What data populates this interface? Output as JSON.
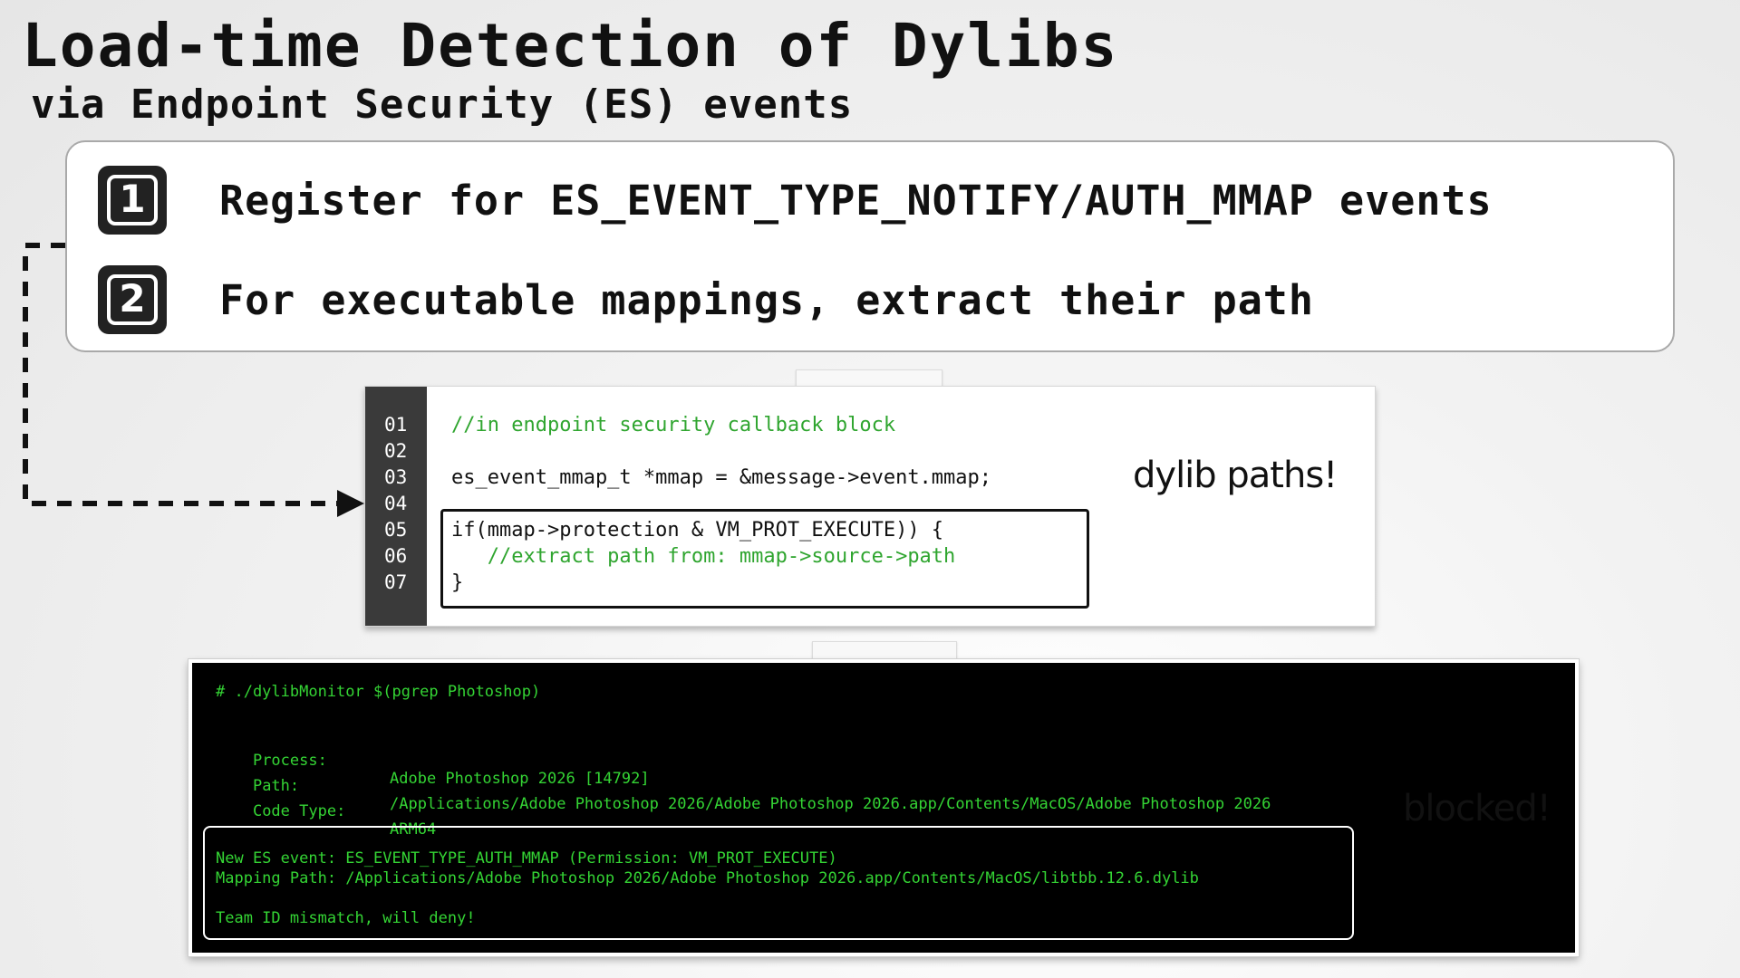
{
  "title": "Load-time Detection of Dylibs",
  "subtitle": "via Endpoint Security (ES) events",
  "steps": [
    {
      "number": "1",
      "text": "Register for ES_EVENT_TYPE_NOTIFY/AUTH_MMAP events"
    },
    {
      "number": "2",
      "text": "For executable mappings, extract their path"
    }
  ],
  "code": {
    "line_numbers": [
      "01",
      "02",
      "03",
      "04",
      "05",
      "06",
      "07"
    ],
    "lines": [
      "//in endpoint security callback block",
      "",
      "es_event_mmap_t *mmap = &message->event.mmap;",
      "",
      "if(mmap->protection & VM_PROT_EXECUTE)) {",
      "   //extract path from: mmap->source->path",
      "}"
    ]
  },
  "annotations": {
    "dylib_paths": "dylib paths!",
    "blocked": "blocked!"
  },
  "terminal": {
    "command": "# ./dylibMonitor $(pgrep Photoshop)",
    "process_label": "Process:",
    "process_value": "Adobe Photoshop 2026 [14792]",
    "path_label": "Path:",
    "path_value": "/Applications/Adobe Photoshop 2026/Adobe Photoshop 2026.app/Contents/MacOS/Adobe Photoshop 2026",
    "code_type_label": "Code Type:",
    "code_type_value": "ARM64",
    "event_line": "New ES event: ES_EVENT_TYPE_AUTH_MMAP (Permission: VM_PROT_EXECUTE)",
    "mapping_line": "Mapping Path: /Applications/Adobe Photoshop 2026/Adobe Photoshop 2026.app/Contents/MacOS/libtbb.12.6.dylib",
    "deny_line": "Team ID mismatch, will deny!"
  },
  "colors": {
    "code_comment": "#2fa52f",
    "terminal_text": "#34d434",
    "terminal_bg": "#000000",
    "gutter_bg": "#3a3a3a"
  }
}
